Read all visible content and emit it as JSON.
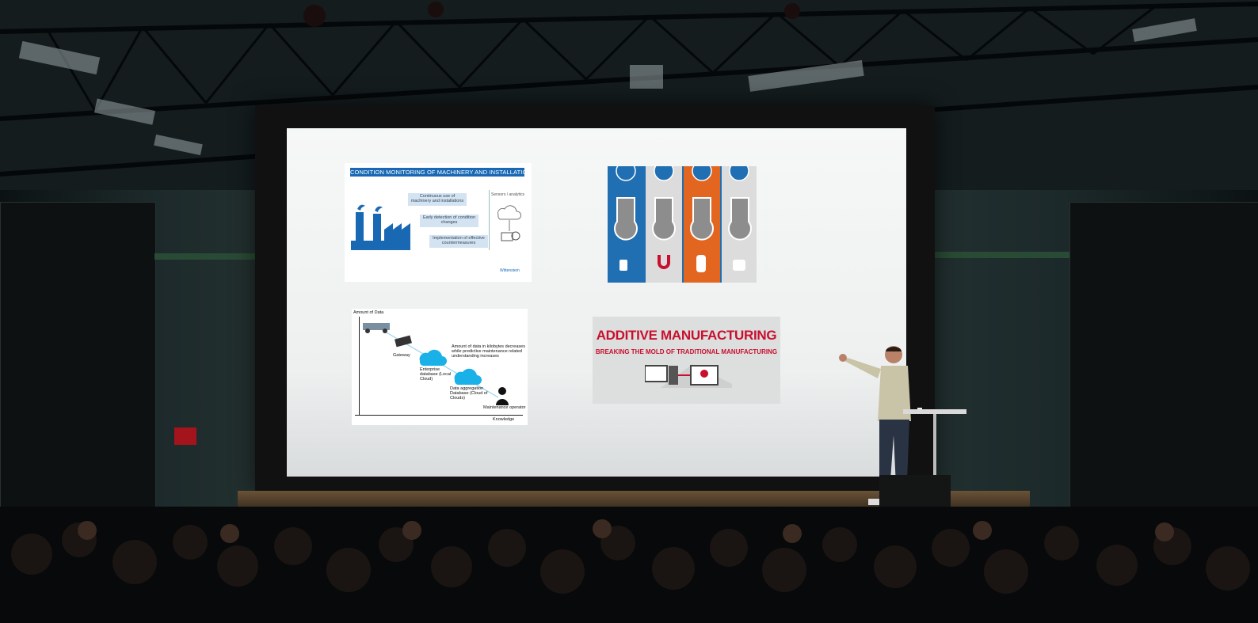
{
  "scene": {
    "description_colors": {
      "screen": "#f1f2f2",
      "stage_light": "#6a5236",
      "accent_red": "#c8102e",
      "accent_blue": "#1868b4"
    }
  },
  "slides": {
    "condition_monitoring": {
      "title": "CONDITION MONITORING OF MACHINERY AND INSTALLATIONS",
      "boxes": [
        "Continuous use of machinery and installations",
        "Early detection of condition changes",
        "Implementation of effective countermeasures"
      ],
      "side_label": "Sensors / analytics",
      "logo_text": "Wittenstein"
    },
    "blue_panels": {
      "labels": [
        "",
        "",
        "",
        ""
      ],
      "colors": [
        "#1f6fb2",
        "#d9d9d9",
        "#e2661f",
        "#d9d9d9"
      ]
    },
    "data_diagram": {
      "y_axis_label": "Amount of Data",
      "x_axis_label": "Knowledge",
      "gateway_label": "Gateway",
      "edge_db_label": "Enterprise database (Local Cloud)",
      "aggregation_label": "Data aggregation Database (Cloud of Clouds)",
      "operator_label": "Maintenance operator",
      "note": "Amount of data in kilobytes decreases while predictive maintenance related understanding increases"
    },
    "additive": {
      "title": "ADDITIVE MANUFACTURING",
      "subtitle": "BREAKING THE MOLD OF TRADITIONAL MANUFACTURING"
    }
  }
}
